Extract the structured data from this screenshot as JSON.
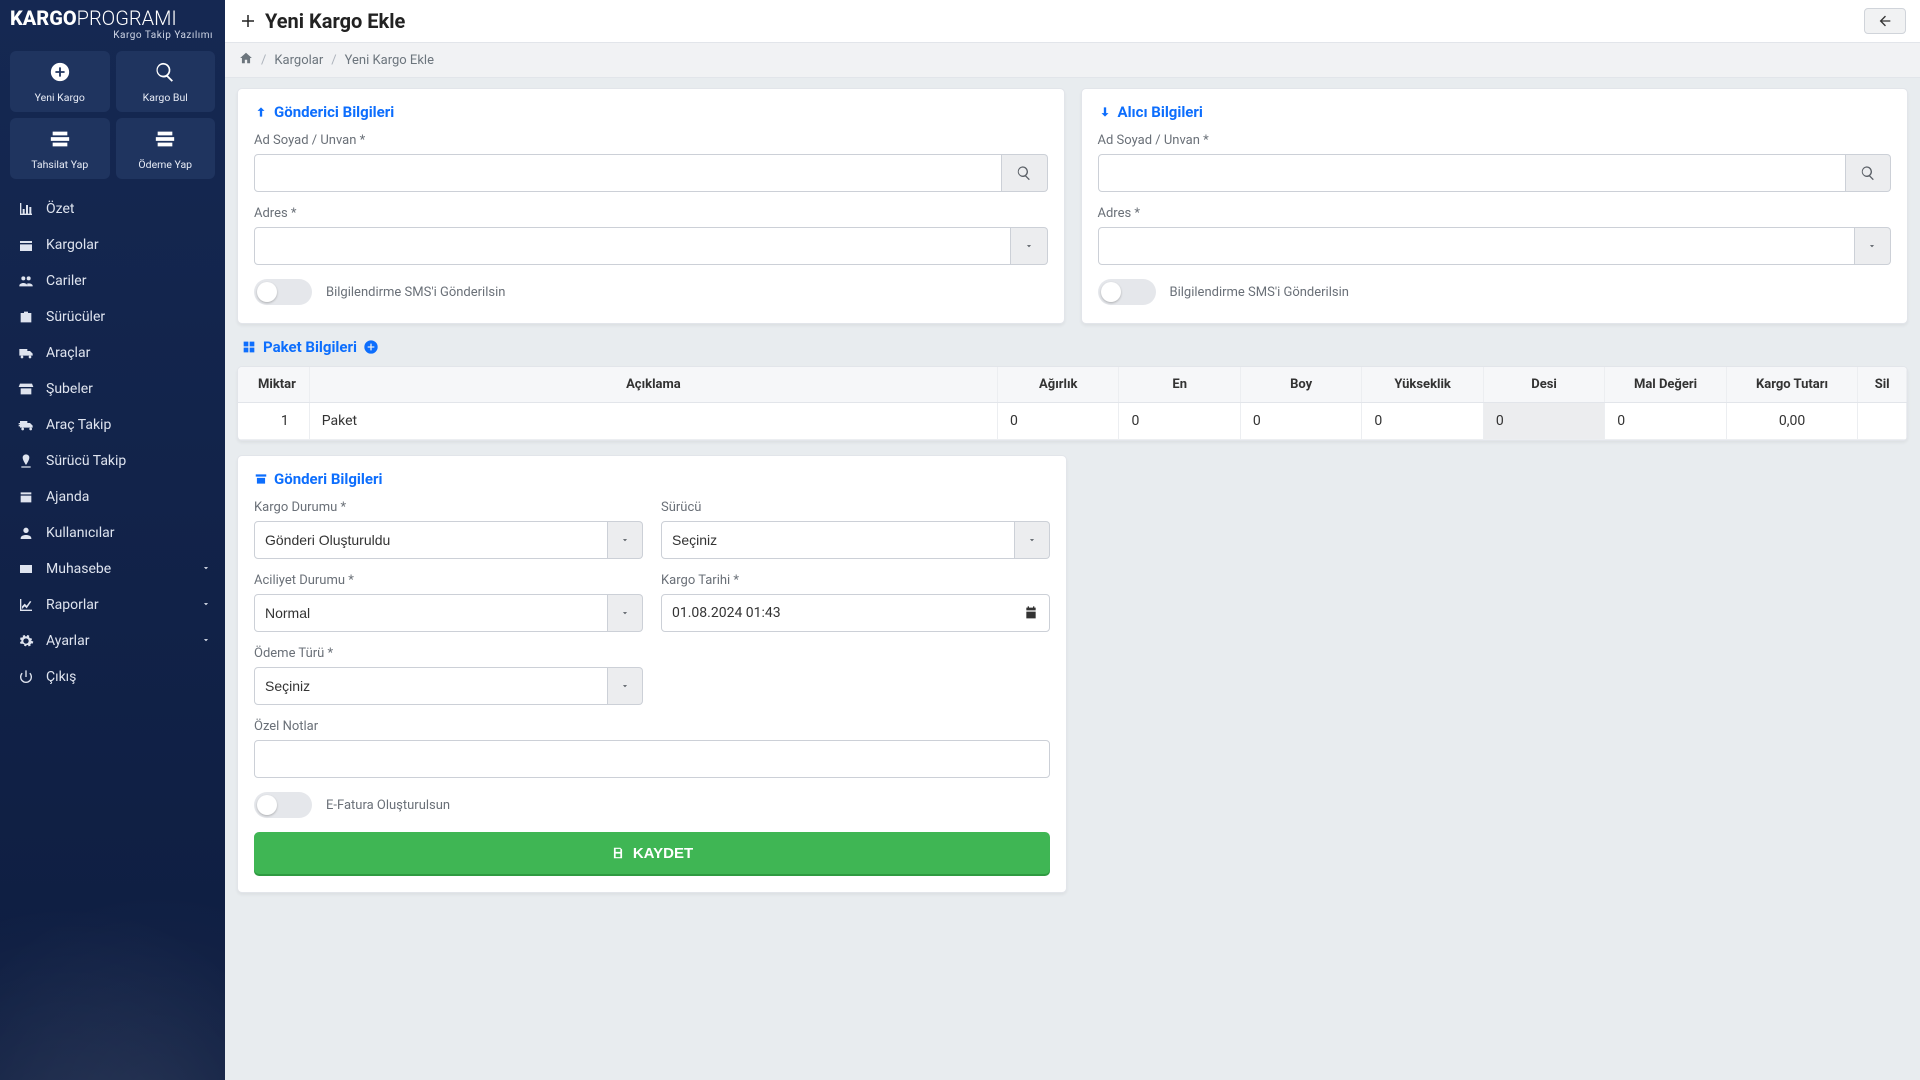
{
  "logo": {
    "brand_bold": "KARGO",
    "brand_light": "PROGRAMI",
    "tagline": "Kargo Takip Yazılımı"
  },
  "quick": {
    "new": "Yeni Kargo",
    "find": "Kargo Bul",
    "collect": "Tahsilat Yap",
    "pay": "Ödeme Yap"
  },
  "nav": {
    "ozet": "Özet",
    "kargolar": "Kargolar",
    "cariler": "Cariler",
    "suruculer": "Sürücüler",
    "araclar": "Araçlar",
    "subeler": "Şubeler",
    "aracTakip": "Araç Takip",
    "surucuTakip": "Sürücü Takip",
    "ajanda": "Ajanda",
    "kullanicilar": "Kullanıcılar",
    "muhasebe": "Muhasebe",
    "raporlar": "Raporlar",
    "ayarlar": "Ayarlar",
    "cikis": "Çıkış"
  },
  "page": {
    "title": "Yeni Kargo Ekle"
  },
  "breadcrumb": {
    "kargolar": "Kargolar",
    "current": "Yeni Kargo Ekle"
  },
  "sender": {
    "title": "Gönderici Bilgileri",
    "name_label": "Ad Soyad / Unvan *",
    "address_label": "Adres *",
    "sms_label": "Bilgilendirme SMS'i Gönderilsin"
  },
  "receiver": {
    "title": "Alıcı Bilgileri",
    "name_label": "Ad Soyad / Unvan *",
    "address_label": "Adres *",
    "sms_label": "Bilgilendirme SMS'i Gönderilsin"
  },
  "packages": {
    "title": "Paket Bilgileri",
    "headers": {
      "miktar": "Miktar",
      "aciklama": "Açıklama",
      "agirlik": "Ağırlık",
      "en": "En",
      "boy": "Boy",
      "yukseklik": "Yükseklik",
      "desi": "Desi",
      "malDegeri": "Mal Değeri",
      "kargoTutari": "Kargo Tutarı",
      "sil": "Sil"
    },
    "rows": [
      {
        "miktar": "1",
        "aciklama": "Paket",
        "agirlik": "0",
        "en": "0",
        "boy": "0",
        "yukseklik": "0",
        "desi": "0",
        "malDegeri": "0",
        "kargoTutari": "0,00",
        "sil": ""
      }
    ]
  },
  "shipment": {
    "title": "Gönderi Bilgileri",
    "status_label": "Kargo Durumu *",
    "status_value": "Gönderi Oluşturuldu",
    "driver_label": "Sürücü",
    "driver_value": "Seçiniz",
    "priority_label": "Aciliyet Durumu *",
    "priority_value": "Normal",
    "date_label": "Kargo Tarihi *",
    "date_value": "01.08.2024 01:43",
    "payment_label": "Ödeme Türü *",
    "payment_value": "Seçiniz",
    "notes_label": "Özel Notlar",
    "einvoice_label": "E-Fatura Oluşturulsun",
    "save": "KAYDET"
  }
}
